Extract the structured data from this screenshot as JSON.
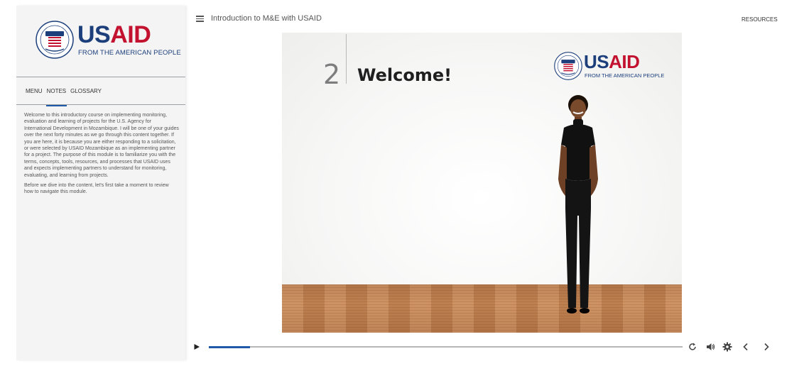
{
  "sidebar": {
    "logo": {
      "wordmark_us": "US",
      "wordmark_aid": "AID",
      "tagline": "FROM THE AMERICAN PEOPLE"
    },
    "tabs": [
      {
        "label": "MENU",
        "active": false
      },
      {
        "label": "NOTES",
        "active": true
      },
      {
        "label": "GLOSSARY",
        "active": false
      }
    ],
    "notes": [
      "Welcome to this introductory course on implementing monitoring, evaluation and learning of projects for the U.S. Agency for International Development in Mozambique. I will be one of your guides over the next forty minutes as we go through this content together. If you are here, it is because you are either responding to a solicitation, or were selected by USAID Mozambique as an implementing partner for a project. The purpose of this module is to familiarize you with the terms, concepts, tools, resources, and processes that USAID uses and expects implementing partners to understand for monitoring, evaluating, and learning from projects.",
      "Before we dive into the content, let's first take a moment to review how to navigate this module."
    ]
  },
  "header": {
    "menu_icon": "hamburger-icon",
    "course_title": "Introduction to M&E with USAID",
    "resources_label": "RESOURCES"
  },
  "slide": {
    "number": "2",
    "heading": "Welcome!",
    "logo": {
      "wordmark_us": "US",
      "wordmark_aid": "AID",
      "tagline": "FROM THE AMERICAN PEOPLE"
    }
  },
  "player": {
    "progress": 0.087,
    "icons": [
      "play-icon",
      "replay-icon",
      "volume-icon",
      "settings-icon",
      "previous-icon",
      "next-icon"
    ]
  },
  "colors": {
    "usaid_blue": "#1c3f7c",
    "usaid_red": "#c3122f",
    "accent": "#1e5aa8"
  }
}
